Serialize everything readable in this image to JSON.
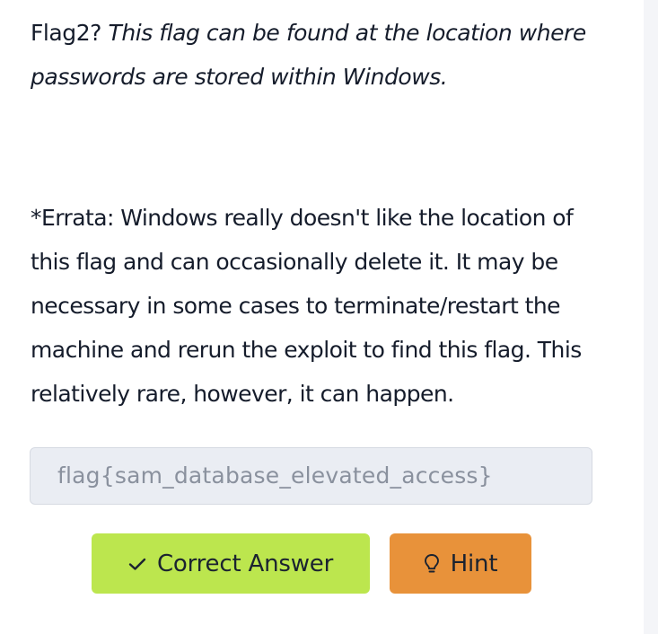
{
  "question": {
    "label": "Flag2?",
    "text": "This flag can be found at the location where passwords are stored within Windows."
  },
  "errata": {
    "text": "*Errata: Windows really doesn't like the location of this flag and can occasionally delete it. It may be necessary in some cases to terminate/restart the machine and rerun the exploit to find this flag. This relatively rare, however, it can happen."
  },
  "answer": {
    "value": "flag{sam_database_elevated_access}"
  },
  "buttons": {
    "correct_label": "Correct Answer",
    "correct_icon": "check-icon",
    "hint_label": "Hint",
    "hint_icon": "lightbulb-icon"
  },
  "colors": {
    "correct_bg": "#bce64e",
    "hint_bg": "#e8923a",
    "answer_bg": "#eaedf3"
  }
}
